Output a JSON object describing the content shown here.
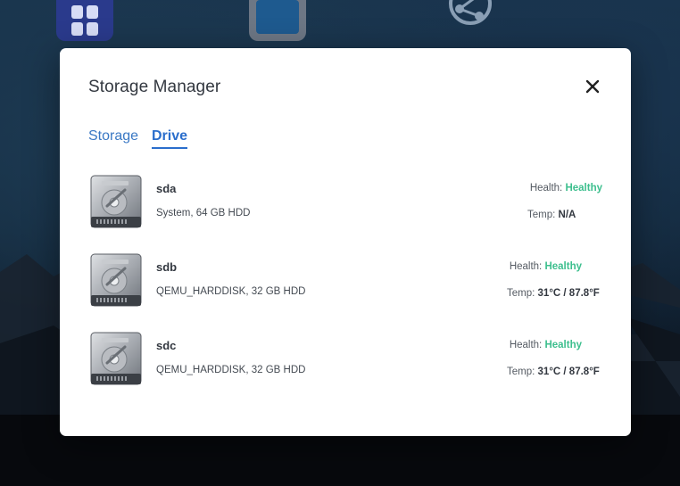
{
  "window": {
    "title": "Storage Manager",
    "close_icon": "close-icon"
  },
  "tabs": [
    {
      "label": "Storage",
      "active": false
    },
    {
      "label": "Drive",
      "active": true
    }
  ],
  "colors": {
    "accent": "#2a6ecc",
    "healthy": "#3dbf8e",
    "title": "#333840"
  },
  "drives": [
    {
      "icon": "hard-disk-icon",
      "name": "sda",
      "description": "System, 64 GB HDD",
      "health_label": "Health:",
      "health_value": "Healthy",
      "temp_label": "Temp:",
      "temp_value": "N/A"
    },
    {
      "icon": "hard-disk-icon",
      "name": "sdb",
      "description": "QEMU_HARDDISK, 32 GB HDD",
      "health_label": "Health:",
      "health_value": "Healthy",
      "temp_label": "Temp:",
      "temp_value": "31°C / 87.8°F"
    },
    {
      "icon": "hard-disk-icon",
      "name": "sdc",
      "description": "QEMU_HARDDISK, 32 GB HDD",
      "health_label": "Health:",
      "health_value": "Healthy",
      "temp_label": "Temp:",
      "temp_value": "31°C / 87.8°F"
    }
  ]
}
